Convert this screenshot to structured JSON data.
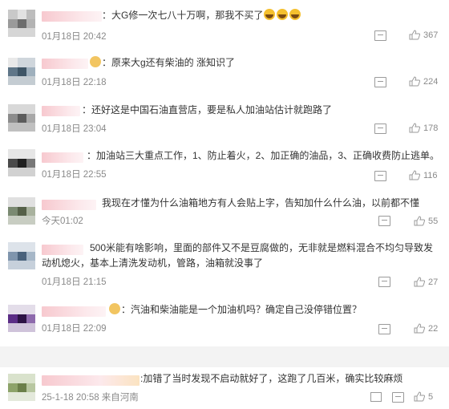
{
  "comments": [
    {
      "text": "：大G修一次七八十万啊，那我不买了",
      "time": "01月18日 20:42",
      "likes": "367"
    },
    {
      "text": "：原来大g还有柴油的 涨知识了",
      "time": "01月18日 22:18",
      "likes": "224"
    },
    {
      "text": "：还好这是中国石油直营店，要是私人加油站估计就跑路了",
      "time": "01月18日 23:04",
      "likes": "178"
    },
    {
      "text": "：加油站三大重点工作，1、防止着火，2、加正确的油品，3、正确收费防止逃单。",
      "time": "01月18日 22:55",
      "likes": "116"
    },
    {
      "text": "我现在才懂为什么油箱地方有人会贴上字，告知加什么什么油，以前都不懂",
      "time": "今天01:02",
      "likes": "55"
    },
    {
      "text": "500米能有啥影响，里面的部件又不是豆腐做的，无非就是燃料混合不均匀导致发动机熄火，基本上清洗发动机，管路，油箱就没事了",
      "time": "01月18日 21:15",
      "likes": "27"
    },
    {
      "text": "：汽油和柴油能是一个加油机吗？确定自己没停错位置？",
      "time": "01月18日 22:09",
      "likes": "22"
    }
  ],
  "bottom": {
    "text": ":加错了当时发现不启动就好了，这跑了几百米，确实比较麻烦",
    "time": "25-1-18 20:58 来自河南",
    "likes": "5"
  },
  "icons": [
    "comment-icon",
    "like-icon",
    "share-icon",
    "crying-emoji-icon",
    "cat-emoji-icon"
  ]
}
